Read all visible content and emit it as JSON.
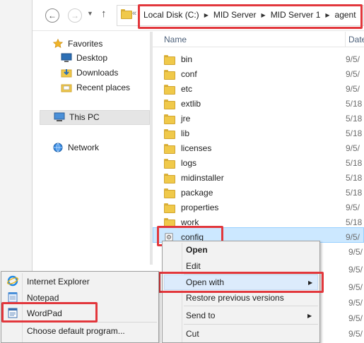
{
  "address": {
    "breadcrumbs": [
      "Local Disk (C:)",
      "MID Server",
      "MID Server 1",
      "agent"
    ],
    "overflow_glyph": "«"
  },
  "toolbar": {
    "back_icon": "back-arrow-icon",
    "forward_icon": "forward-arrow-icon",
    "recent_icon": "chevron-down-icon",
    "up_icon": "up-arrow-icon",
    "back_glyph": "←",
    "forward_glyph": "→",
    "recent_glyph": "▼",
    "up_glyph": "↑"
  },
  "nav": {
    "favorites_label": "Favorites",
    "favorites_items": [
      "Desktop",
      "Downloads",
      "Recent places"
    ],
    "this_pc_label": "This PC",
    "network_label": "Network"
  },
  "columns": {
    "name": "Name",
    "date": "Date"
  },
  "files": [
    {
      "name": "bin",
      "date": "9/5/",
      "type": "folder"
    },
    {
      "name": "conf",
      "date": "9/5/",
      "type": "folder"
    },
    {
      "name": "etc",
      "date": "9/5/",
      "type": "folder"
    },
    {
      "name": "extlib",
      "date": "5/18",
      "type": "folder"
    },
    {
      "name": "jre",
      "date": "5/18",
      "type": "folder"
    },
    {
      "name": "lib",
      "date": "5/18",
      "type": "folder"
    },
    {
      "name": "licenses",
      "date": "9/5/",
      "type": "folder"
    },
    {
      "name": "logs",
      "date": "5/18",
      "type": "folder"
    },
    {
      "name": "midinstaller",
      "date": "5/18",
      "type": "folder"
    },
    {
      "name": "package",
      "date": "5/18",
      "type": "folder"
    },
    {
      "name": "properties",
      "date": "9/5/",
      "type": "folder"
    },
    {
      "name": "work",
      "date": "5/18",
      "type": "folder"
    },
    {
      "name": "config",
      "date": "9/5/",
      "type": "file",
      "selected": true
    }
  ],
  "extra_dates": [
    "9/5/",
    "9/5/",
    "9/5/",
    "9/5/",
    "9/5/",
    "9/5/"
  ],
  "context_menu": {
    "open": "Open",
    "edit": "Edit",
    "open_with": "Open with",
    "restore": "Restore previous versions",
    "send_to": "Send to",
    "cut": "Cut",
    "submenu_arrow": "▶"
  },
  "open_with_menu": {
    "items": [
      "Internet Explorer",
      "Notepad",
      "WordPad"
    ],
    "choose_default": "Choose default program..."
  },
  "colors": {
    "highlight": "#e2373c",
    "selection": "#cce8ff",
    "menu_hover": "#dcebfc"
  }
}
